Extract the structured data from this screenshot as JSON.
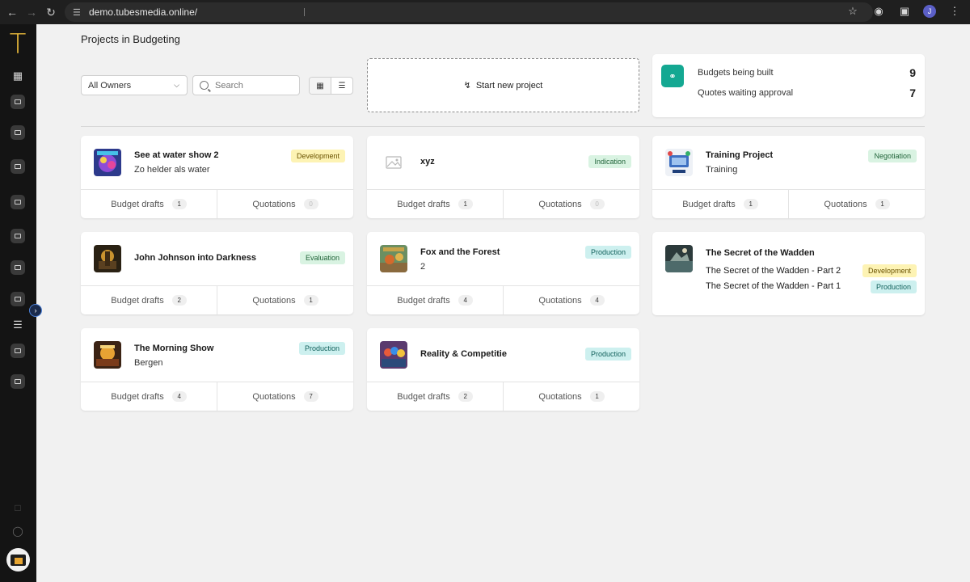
{
  "browser": {
    "url": "demo.tubesmedia.online/",
    "profile_initial": "J"
  },
  "app": {
    "logo": "T"
  },
  "page": {
    "title": "Projects in Budgeting"
  },
  "filters": {
    "owner": "All Owners",
    "search_placeholder": "Search"
  },
  "start_project": {
    "label": "Start new project"
  },
  "stats": [
    {
      "label": "Budgets being built",
      "value": "9"
    },
    {
      "label": "Quotes waiting approval",
      "value": "7"
    }
  ],
  "labels": {
    "budget_drafts": "Budget drafts",
    "quotations": "Quotations"
  },
  "projects": [
    {
      "title": "See at water show 2",
      "subtitle": "Zo helder als water",
      "status": "Development",
      "budget_drafts": "1",
      "quotations": "0"
    },
    {
      "title": "xyz",
      "subtitle": "",
      "status": "Indication",
      "budget_drafts": "1",
      "quotations": "0"
    },
    {
      "title": "Training Project",
      "subtitle": "Training",
      "status": "Negotiation",
      "budget_drafts": "1",
      "quotations": "1"
    },
    {
      "title": "John Johnson into Darkness",
      "subtitle": "",
      "status": "Evaluation",
      "budget_drafts": "2",
      "quotations": "1"
    },
    {
      "title": "Fox and the Forest",
      "subtitle": "2",
      "status": "Production",
      "budget_drafts": "4",
      "quotations": "4"
    },
    {
      "title": "The Secret of the Wadden",
      "episodes": [
        {
          "title": "The Secret of the Wadden - Part 2",
          "status": "Development"
        },
        {
          "title": "The Secret of the Wadden - Part 1",
          "status": "Production"
        }
      ]
    },
    {
      "title": "The Morning Show",
      "subtitle": "Bergen",
      "status": "Production",
      "budget_drafts": "4",
      "quotations": "7"
    },
    {
      "title": "Reality & Competitie",
      "subtitle": "",
      "status": "Production",
      "budget_drafts": "2",
      "quotations": "1"
    }
  ],
  "colors": {
    "accent": "#14a892",
    "logo": "#e8b93a",
    "sidebar": "#141414"
  }
}
